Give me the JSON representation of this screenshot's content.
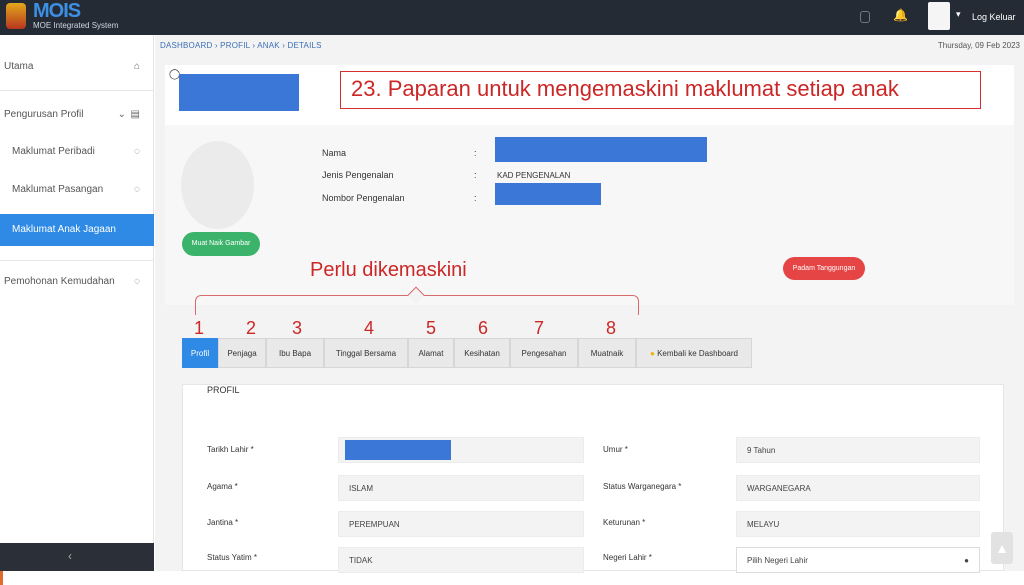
{
  "topbar": {
    "logo_main": "MOIS",
    "logo_sub": "MOE Integrated System",
    "bell_icon": "bell-icon",
    "caret": "▾",
    "logout_label": "Log Keluar"
  },
  "sidebar": {
    "items": [
      {
        "label": "Utama",
        "icon": "⌂"
      },
      {
        "label": "Pengurusan Profil",
        "icon": "▤"
      },
      {
        "label": "Maklumat Peribadi",
        "icon": "◌"
      },
      {
        "label": "Maklumat Pasangan",
        "icon": "◌"
      },
      {
        "label": "Maklumat Anak Jagaan",
        "icon": ""
      },
      {
        "label": "Pemohonan Kemudahan",
        "icon": "◌"
      }
    ],
    "collapse_icon": "‹",
    "chevron": "⌄"
  },
  "breadcrumb": "DASHBOARD  ›  PROFIL  ›  ANAK  ›  DETAILS",
  "date": "Thursday, 09 Feb 2023",
  "annotation_title": "23. Paparan untuk mengemaskini maklumat setiap anak",
  "annotation_perlu": "Perlu dikemaskini",
  "profile": {
    "photo_button": "Muat Naik Gambar",
    "fields": [
      {
        "label": "Nama",
        "colon": ":",
        "value": ""
      },
      {
        "label": "Jenis Pengenalan",
        "colon": ":",
        "value": "KAD PENGENALAN"
      },
      {
        "label": "Nombor Pengenalan",
        "colon": ":",
        "value": ""
      }
    ],
    "remove_button": "Padam Tanggungan"
  },
  "tab_numbers": [
    "1",
    "2",
    "3",
    "4",
    "5",
    "6",
    "7",
    "8"
  ],
  "tabs": [
    {
      "label": "Profil"
    },
    {
      "label": "Penjaga"
    },
    {
      "label": "Ibu Bapa"
    },
    {
      "label": "Tinggal Bersama"
    },
    {
      "label": "Alamat"
    },
    {
      "label": "Kesihatan"
    },
    {
      "label": "Pengesahan"
    },
    {
      "label": "Muatnaik"
    },
    {
      "label": "Kembali ke Dashboard"
    }
  ],
  "form": {
    "title": "PROFIL",
    "fields": [
      {
        "label": "Tarikh Lahir *",
        "value": ""
      },
      {
        "label": "Umur *",
        "value": "9 Tahun"
      },
      {
        "label": "Agama *",
        "value": "ISLAM"
      },
      {
        "label": "Status Warganegara *",
        "value": "WARGANEGARA"
      },
      {
        "label": "Jantina *",
        "value": "PEREMPUAN"
      },
      {
        "label": "Keturunan *",
        "value": "MELAYU"
      },
      {
        "label": "Status Yatim *",
        "value": "TIDAK"
      },
      {
        "label": "Negeri Lahir *",
        "value": "Pilih Negeri Lahir"
      }
    ]
  },
  "colors": {
    "accent": "#2f8ae5",
    "topbar": "#252b35",
    "annotation": "#cc2727",
    "redaction": "#3b77d6",
    "success": "#3bb36a",
    "danger": "#e54545"
  }
}
